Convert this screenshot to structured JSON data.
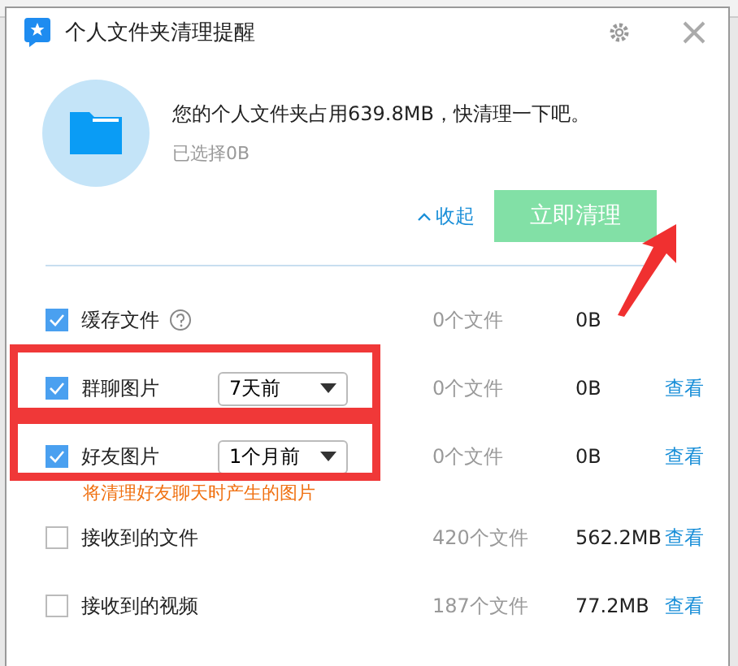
{
  "window": {
    "title": "个人文件夹清理提醒"
  },
  "summary": {
    "message": "您的个人文件夹占用639.8MB，快清理一下吧。",
    "selected": "已选择0B"
  },
  "actions": {
    "collapse": "收起",
    "clean": "立即清理"
  },
  "rows": [
    {
      "kind": "help",
      "checked": true,
      "label": "缓存文件",
      "count": "0个文件",
      "size": "0B"
    },
    {
      "kind": "dropdown",
      "checked": true,
      "label": "群聊图片",
      "period": "7天前",
      "count": "0个文件",
      "size": "0B",
      "link": "查看"
    },
    {
      "kind": "dropdown",
      "checked": true,
      "label": "好友图片",
      "period": "1个月前",
      "count": "0个文件",
      "size": "0B",
      "link": "查看",
      "hint": "将清理好友聊天时产生的图片"
    },
    {
      "kind": "plain",
      "checked": false,
      "label": "接收到的文件",
      "count": "420个文件",
      "size": "562.2MB",
      "link": "查看"
    },
    {
      "kind": "plain",
      "checked": false,
      "label": "接收到的视频",
      "count": "187个文件",
      "size": "77.2MB",
      "link": "查看"
    }
  ]
}
